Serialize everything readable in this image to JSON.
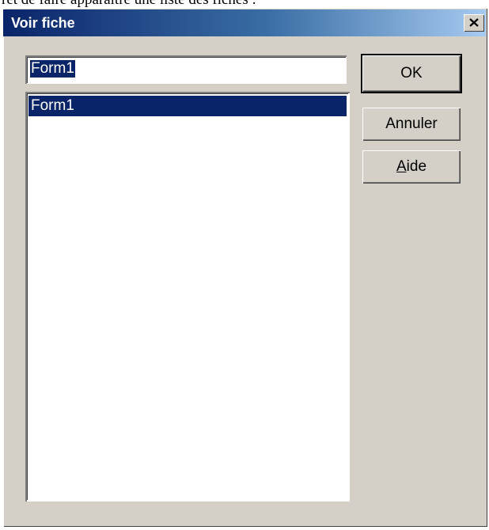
{
  "caption": "ret de faire apparaître une liste des fiches :",
  "window": {
    "title": "Voir fiche",
    "close_glyph": "✕"
  },
  "form": {
    "name_value": "Form1",
    "list_items": [
      "Form1"
    ]
  },
  "buttons": {
    "ok_label": "OK",
    "cancel_label": "Annuler",
    "help_mnemonic": "A",
    "help_rest": "ide"
  },
  "colors": {
    "title_gradient_start": "#0a246a",
    "title_gradient_end": "#a6caf0",
    "selection": "#0a246a",
    "face": "#d4d0c8"
  },
  "icons": {
    "close": "close-icon"
  }
}
